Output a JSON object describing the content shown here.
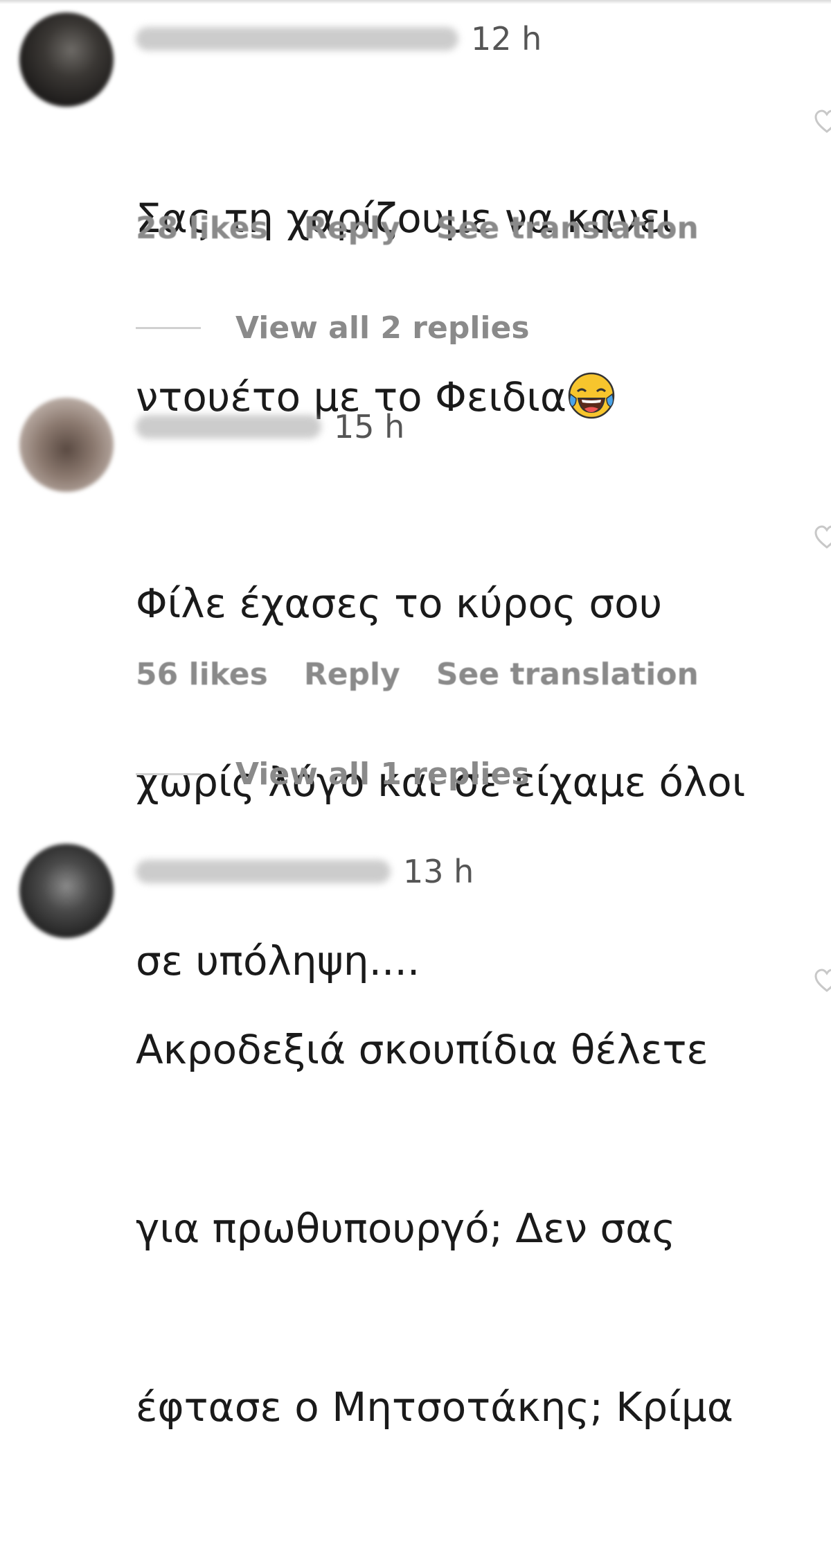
{
  "comments": [
    {
      "time": "12 h",
      "text_lines": [
        "Σας τη χαρίζουμε να κανει",
        "ντουέτο με το Φειδια"
      ],
      "emoji": "face-with-tears-of-joy",
      "likes": "28 likes",
      "reply": "Reply",
      "translate": "See translation",
      "view_replies": "View all 2 replies"
    },
    {
      "time": "15 h",
      "text_lines": [
        "Φίλε έχασες το κύρος σου",
        "χωρίς λόγο και σε είχαμε όλοι",
        "σε υπόληψη...."
      ],
      "likes": "56 likes",
      "reply": "Reply",
      "translate": "See translation",
      "view_replies": "View all 1 replies"
    },
    {
      "time": "13 h",
      "text_lines": [
        "Ακροδεξιά σκουπίδια θέλετε",
        "για πρωθυπουργό; Δεν σας",
        "έφτασε ο Μητσοτάκης; Κρίμα"
      ]
    }
  ],
  "icons": {
    "like": "heart-icon",
    "emoji": "face-with-tears-of-joy"
  },
  "colors": {
    "text": "#1a1a1a",
    "secondary": "#8a8a8a",
    "time": "#555555"
  }
}
